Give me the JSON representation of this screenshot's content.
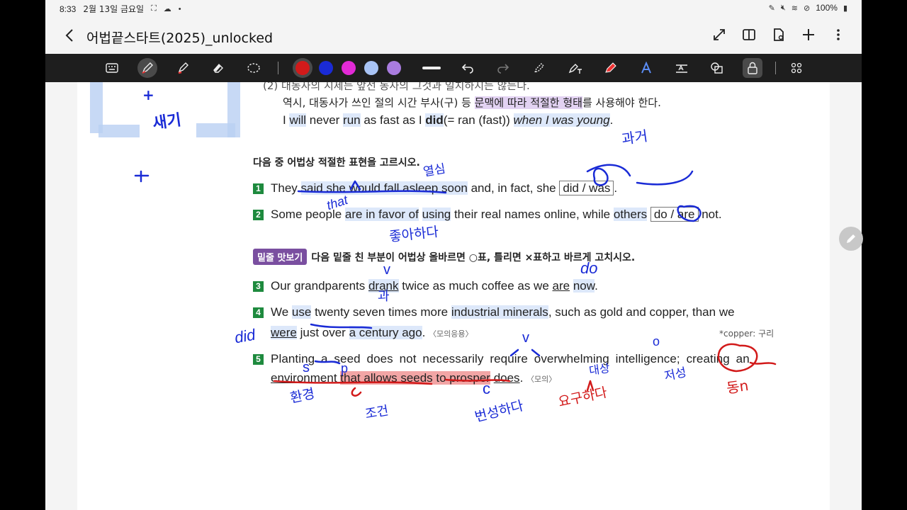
{
  "status": {
    "time": "8:33",
    "date": "2월 13일 금요일",
    "battery": "100%"
  },
  "title": "어법끝스타트(2025)_unlocked",
  "colors": {
    "pen_red": "#d21a1a",
    "pen_blue": "#1a2bd6",
    "pen_magenta": "#e22ad6",
    "pen_lightblue": "#a9c4f5",
    "pen_purple": "#a97cdf"
  },
  "content": {
    "top_line": "(2) 대동사의 시제는 앞선 동사의 그것과 일치하지는 않는다.",
    "rule_pre": "역시, 대동사가 쓰인 절의 시간 부사(구) 등 ",
    "rule_hl": "문맥에 따라 적절한 형태",
    "rule_post": "를 사용해야 한다.",
    "ex_a": "I ",
    "ex_will": "will",
    "ex_b": " never ",
    "ex_run": "run",
    "ex_c": " as fast as I ",
    "ex_did": "did",
    "ex_d": "(= ran (fast)) ",
    "ex_e": "when I was young",
    "ex_f": ".",
    "q1_heading": "다음 중 어법상 적절한 표현을 고르시오.",
    "q1": {
      "num": "1",
      "a": "They ",
      "b": "said she would fall asleep soon",
      "c": " and, in fact, she ",
      "choice": "did / was",
      "d": "."
    },
    "q2": {
      "num": "2",
      "a": "Some people ",
      "b": "are in favor of",
      "c": " ",
      "d": "using",
      "e": " their real names online, while ",
      "f": "others",
      "g": " ",
      "choice": "do / are",
      "h": " not."
    },
    "q2_badge": "밑줄 맛보기",
    "q2_heading": "다음 밑줄 친 부분이 어법상 올바르면 ○표, 틀리면 ×표하고 바르게 고치시오.",
    "q3": {
      "num": "3",
      "a": "Our grandparents ",
      "b": "drank",
      "c": " twice as much coffee as we ",
      "d": "are",
      "e": " ",
      "f": "now",
      "g": "."
    },
    "q4": {
      "num": "4",
      "a": "We ",
      "b": "use",
      "c": " twenty seven times more ",
      "d": "industrial minerals",
      "e": ", such as gold and copper, than we",
      "line2_a": "were",
      "line2_b": " just over ",
      "line2_c": "a century ago",
      "line2_d": ".",
      "source": "〈모의응용〉",
      "footnote": "*copper: 구리"
    },
    "q5": {
      "num": "5",
      "line1": "Planting a seed does not necessarily require overwhelming intelligence; creating an",
      "l2_a": "environment ",
      "l2_b": "that allows seeds to prosper",
      "l2_c": " ",
      "l2_d": "does",
      "l2_e": ".",
      "source": "〈모의〉"
    }
  },
  "handwriting": {
    "note_plus": "+",
    "note_saegi": "새기",
    "note_gwageo": "과거",
    "note_yeolsim": "열심",
    "note_that": "that",
    "note_choahada": "좋아하다",
    "note_do": "do",
    "note_did": "did",
    "note_gwa": "과",
    "note_v1": "v",
    "note_v2": "v",
    "note_o": "o",
    "note_s": "s",
    "note_pa": "p",
    "note_c": "c",
    "note_hwangyeong": "환경",
    "note_jokeon": "조건",
    "note_beonseonghada": "번성하다",
    "note_daesang": "대상",
    "note_yoguhada": "요구하다",
    "note_jeoseong": "저성",
    "note_dongn": "동n"
  }
}
